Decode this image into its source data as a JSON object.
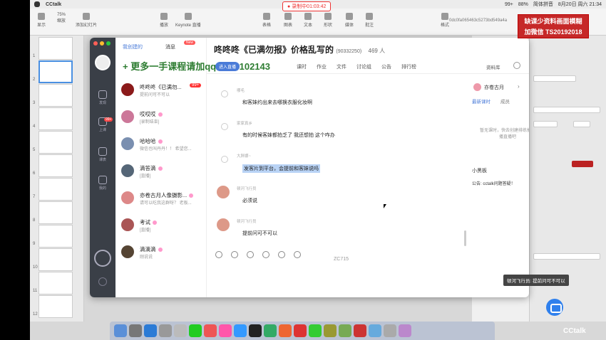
{
  "menubar": {
    "app_name": "CCtalk",
    "status": [
      "99+",
      "88%",
      "简体拼音",
      "8月20日 周六 21:34"
    ]
  },
  "keynote": {
    "zoom": "75%",
    "left_labels": [
      "显示",
      "缩放",
      "添加幻灯片"
    ],
    "tools": [
      "播放",
      "Keynote 直播",
      "表格",
      "图表",
      "文本",
      "形状",
      "媒体",
      "批注"
    ],
    "recording": "● 录制中01:03:42",
    "user_id": "0dc0fa065463c5273bd549a4a",
    "right_label": "格式"
  },
  "banner": {
    "line1": "缺课少资料画面模糊",
    "line2": "加微信 TS20192018"
  },
  "slides": [
    "1",
    "2",
    "3",
    "4",
    "5",
    "6",
    "7",
    "8",
    "9",
    "10",
    "11",
    "12"
  ],
  "sidebar": {
    "items": [
      {
        "label": "发现"
      },
      {
        "label": "上课",
        "badge": "99+"
      },
      {
        "label": "课表"
      },
      {
        "label": "我的"
      }
    ]
  },
  "conv_list": {
    "tabs": [
      "我创建的",
      "消息"
    ],
    "new_badge": "New",
    "items": [
      {
        "name": "咚咚咚《已满勿...",
        "sub": "提前问可不可以",
        "unread": "99+",
        "color": "#8b1a1a"
      },
      {
        "name": "哎哎哎",
        "sub": "[录制结束]",
        "color": "#c79"
      },
      {
        "name": "哈哈哈",
        "sub": "微信也叫丹丹！！ 希望您...",
        "color": "#7a8fb0"
      },
      {
        "name": "滴答滴",
        "sub": "[直播]",
        "color": "#567"
      },
      {
        "name": "亦卷古月人像摄影...",
        "sub": "请可以吃我这群呀？ 老板...",
        "color": "#d88"
      },
      {
        "name": "考试",
        "sub": "[直播]",
        "color": "#a55"
      },
      {
        "name": "滴滴滴",
        "sub": "刚说说",
        "color": "#543"
      }
    ]
  },
  "chat": {
    "title": "咚咚咚《已满勿报》价格乱写的",
    "group_id": "(90332250)",
    "member_count": "469 人",
    "promo": "+ 更多一手课程请加qq 2974102143",
    "live_label": "进入直播",
    "nav": [
      "课时",
      "作业",
      "文件",
      "讨论组",
      "公告",
      "排行榜"
    ],
    "resource_lib": "资料库",
    "messages": [
      {
        "sender": "哪毛",
        "text": "和客妹约出来去哪换衣服化妆啊",
        "highlight": false
      },
      {
        "sender": "家家真乡",
        "text": "有的时候客妹都拍乏了 我还想拍 这个咋办",
        "highlight": false
      },
      {
        "sender": "大胖娜~",
        "text": "发客片到平台，会提前和客妹说吗",
        "highlight": true
      },
      {
        "sender": "顿河飞行员",
        "text": "必须说",
        "highlight": false
      },
      {
        "sender": "顿河飞行员",
        "text": "提前问可不可以",
        "highlight": false
      }
    ],
    "watermark": "ZC715"
  },
  "right_panel": {
    "teacher": "亦卷古月",
    "tabs": [
      "最新课时",
      "成员"
    ],
    "empty": "暂无课时，快去创建排练拍直播直播吧",
    "board_title": "小黑板",
    "notice": "公告: cctalk问题答疑！"
  },
  "toast": "顿河飞行员: 提前问可不可以",
  "dock_colors": [
    "#5a8fd8",
    "#777",
    "#2b7bd6",
    "#999",
    "#bbb",
    "#2c2",
    "#e55",
    "#f5a",
    "#39f",
    "#222",
    "#3a6",
    "#e63",
    "#d33",
    "#3c3",
    "#993",
    "#7a5",
    "#c33",
    "#6ad",
    "#aaa",
    "#b8c"
  ],
  "footer_logo": "CCtalk"
}
